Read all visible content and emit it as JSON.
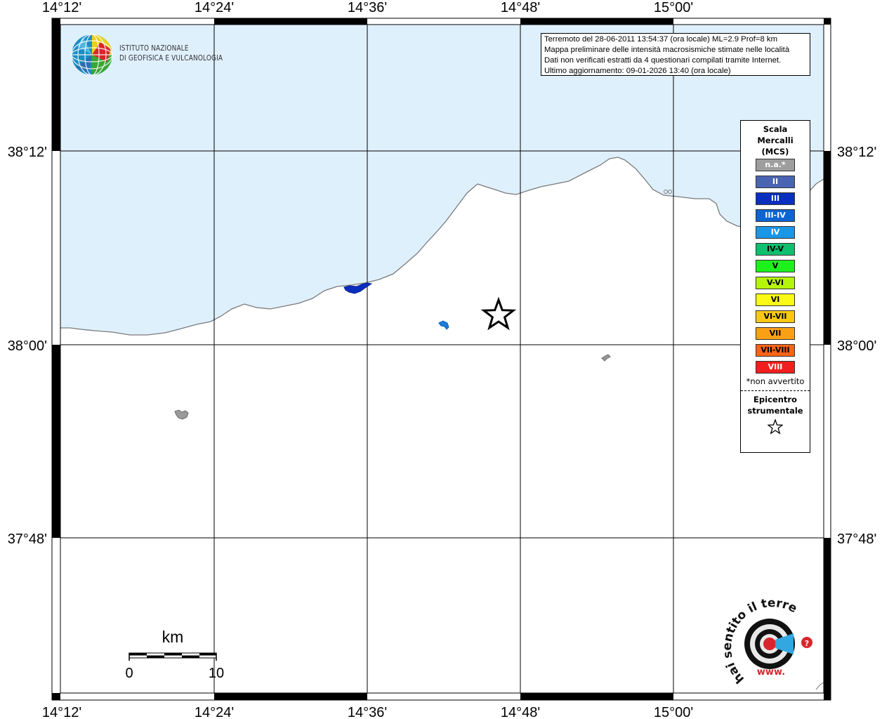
{
  "map": {
    "lon_labels": [
      "14°12'",
      "14°24'",
      "14°36'",
      "14°48'",
      "15°00'"
    ],
    "lat_labels": [
      "38°12'",
      "38°00'",
      "37°48'"
    ],
    "sea_color": "#dff0fd",
    "land_color": "#ffffff"
  },
  "institute": {
    "name_line1": "ISTITUTO NAZIONALE",
    "name_line2": "DI GEOFISICA E VULCANOLOGIA"
  },
  "info": {
    "line1": "Terremoto del 28-06-2011 13:54:37 (ora locale) ML=2.9 Prof=8 km",
    "line2": "Mappa preliminare delle intensità macrosismiche stimate nelle località",
    "line3": "Dati non verificati estratti da 4 questionari compilati tramite Internet.",
    "line4": "Ultimo aggiornamento: 09-01-2026 13:40 (ora locale)"
  },
  "legend": {
    "title_line1": "Scala",
    "title_line2": "Mercalli",
    "title_line3": "(MCS)",
    "items": [
      {
        "label": "n.a.*",
        "color": "#9e9e9e",
        "text_color": "#ffffff"
      },
      {
        "label": "II",
        "color": "#4a64b4",
        "text_color": "#ffffff"
      },
      {
        "label": "III",
        "color": "#0a2fbf",
        "text_color": "#ffffff"
      },
      {
        "label": "III-IV",
        "color": "#0a64d2",
        "text_color": "#ffffff"
      },
      {
        "label": "IV",
        "color": "#1a96e6",
        "text_color": "#ffffff"
      },
      {
        "label": "IV-V",
        "color": "#0fbe6e",
        "text_color": "#000000"
      },
      {
        "label": "V",
        "color": "#1ef01e",
        "text_color": "#000000"
      },
      {
        "label": "V-VI",
        "color": "#b4f50a",
        "text_color": "#000000"
      },
      {
        "label": "VI",
        "color": "#fafa14",
        "text_color": "#000000"
      },
      {
        "label": "VI-VII",
        "color": "#fac814",
        "text_color": "#000000"
      },
      {
        "label": "VII",
        "color": "#faa014",
        "text_color": "#000000"
      },
      {
        "label": "VII-VIII",
        "color": "#fa6414",
        "text_color": "#000000"
      },
      {
        "label": "VIII",
        "color": "#f01e1e",
        "text_color": "#ffffff"
      }
    ],
    "note": "*non avvertito",
    "epicenter_line1": "Epicentro",
    "epicenter_line2": "strumentale",
    "epicenter_symbol": "star-icon"
  },
  "scale_bar": {
    "unit": "km",
    "min_label": "0",
    "max_label": "10"
  },
  "observations": [
    {
      "name": "blue-patch-coast",
      "intensity": "III",
      "color": "#0a2fbf"
    },
    {
      "name": "lightblue-patch-inland",
      "intensity": "III-IV",
      "color": "#1a7adc"
    }
  ],
  "site_logo": {
    "text": "hai sentito il terremoto.it",
    "url_text": "www."
  }
}
